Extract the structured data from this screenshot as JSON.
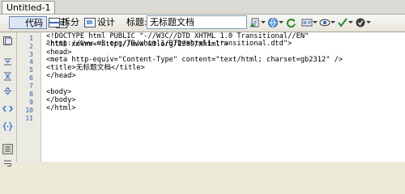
{
  "document": {
    "tab_title": "Untitled-1"
  },
  "toolbar": {
    "code_label": "代码",
    "split_label": "拆分",
    "design_label": "设计",
    "title_label": "标题:",
    "title_value": "无标题文档"
  },
  "editor": {
    "lines": [
      {
        "n": "1",
        "parts": [
          "<!DOCTYPE html PUBLIC \"-//W3C//DTD XHTML 1.0 Transitional//EN\"",
          "\"http://www.w3.org/TR/xhtml1/DTD/xhtml1-transitional.dtd\">"
        ]
      },
      {
        "n": "2",
        "parts": [
          "<html xmlns=\"http://www.w3.org/1999/xhtml\">"
        ]
      },
      {
        "n": "3",
        "parts": [
          "<head>"
        ]
      },
      {
        "n": "4",
        "parts": [
          "<meta http-equiv=\"Content-Type\" content=\"text/html; charset=gb2312\" />"
        ]
      },
      {
        "n": "5",
        "parts": [
          "<title>无标题文档</title>"
        ]
      },
      {
        "n": "6",
        "parts": [
          "</head>"
        ]
      },
      {
        "n": "7",
        "parts": [
          ""
        ]
      },
      {
        "n": "8",
        "parts": [
          "<body>"
        ]
      },
      {
        "n": "9",
        "parts": [
          "</body>"
        ]
      },
      {
        "n": "10",
        "parts": [
          "</html>"
        ]
      },
      {
        "n": "11",
        "parts": [
          ""
        ]
      }
    ]
  },
  "colors": {
    "line_number": "#3059b0",
    "active_view_bg": "#dde6f5"
  },
  "icons": [
    "code-view-icon",
    "split-view-icon",
    "design-view-icon",
    "file-management-icon",
    "preview-browser-icon",
    "refresh-icon",
    "view-options-icon",
    "visual-aids-icon",
    "validate-markup-icon",
    "check-compatibility-icon",
    "open-documents-icon",
    "collapse-tag-icon",
    "collapse-selection-icon",
    "expand-all-icon",
    "select-parent-tag-icon",
    "balance-braces-icon",
    "line-numbers-icon",
    "word-wrap-icon"
  ]
}
